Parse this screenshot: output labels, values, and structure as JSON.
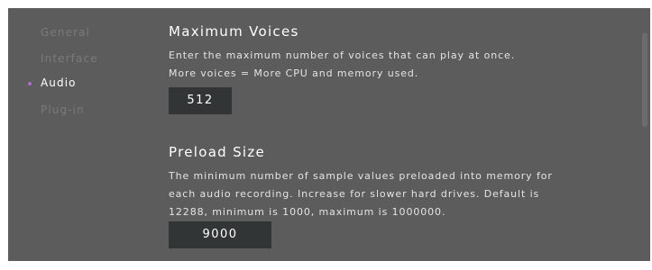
{
  "sidebar": {
    "items": [
      {
        "label": "General"
      },
      {
        "label": "Interface"
      },
      {
        "label": "Audio"
      },
      {
        "label": "Plug-in"
      }
    ],
    "active_index": 2,
    "active_indicator_color": "#b06ad8"
  },
  "sections": [
    {
      "title": "Maximum Voices",
      "description_lines": [
        "Enter the maximum number of voices that can play at once.",
        "More voices = More CPU and memory used."
      ],
      "value": "512"
    },
    {
      "title": "Preload Size",
      "description_lines": [
        "The minimum number of sample values preloaded into memory for",
        "each audio recording. Increase for slower hard drives. Default is",
        "12288, minimum is 1000, maximum is 1000000."
      ],
      "value": "9000"
    }
  ],
  "colors": {
    "background": "#5c5c5c",
    "input_background": "#323536",
    "inactive_nav": "#7a7a7a",
    "text": "#ffffff"
  }
}
